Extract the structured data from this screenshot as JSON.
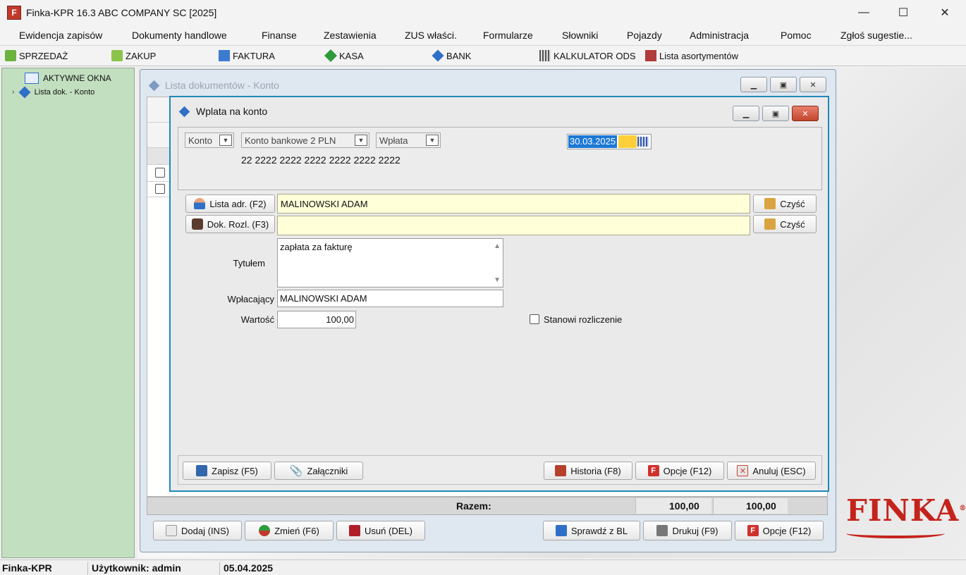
{
  "app": {
    "title": "Finka-KPR 16.3 ABC COMPANY SC [2025]",
    "icon": "finka-app-icon"
  },
  "window_controls": {
    "minimize": "—",
    "maximize": "☐",
    "close": "✕"
  },
  "menu": [
    "Ewidencja zapisów",
    "Dokumenty handlowe",
    "Finanse",
    "Zestawienia",
    "ZUS właści.",
    "Formularze",
    "Słowniki",
    "Pojazdy",
    "Administracja",
    "Pomoc",
    "Zgłoś sugestie..."
  ],
  "toolbar": [
    "SPRZEDAŻ",
    "ZAKUP",
    "FAKTURA",
    "KASA",
    "BANK",
    "KALKULATOR ODS",
    "Lista asortymentów"
  ],
  "tree": {
    "root": "AKTYWNE OKNA",
    "child": "Lista dok. - Konto"
  },
  "outer": {
    "title": "Lista dokumentów - Konto",
    "razem_label": "Razem:",
    "razem_value1": "100,00",
    "razem_value2": "100,00",
    "buttons": {
      "add": "Dodaj (INS)",
      "change": "Zmień (F6)",
      "delete": "Usuń (DEL)",
      "check": "Sprawdź z BL",
      "print": "Drukuj (F9)",
      "options": "Opcje (F12)"
    }
  },
  "dialog": {
    "title": "Wplata na konto",
    "combo_konto": "Konto",
    "combo_account": "Konto bankowe 2 PLN",
    "combo_type": "Wpłata",
    "account_number": "22 2222 2222 2222 2222 2222 2222",
    "date": "30.03.2025",
    "btn_lista_adr": "Lista adr. (F2)",
    "lista_adr_value": "MALINOWSKI ADAM",
    "btn_dok_rozl": "Dok. Rozl. (F3)",
    "dok_rozl_value": "",
    "btn_clear": "Czyść",
    "label_tytulem": "Tytułem",
    "tytulem_value": "zapłata za fakturę",
    "label_wplacajacy": "Wpłacający",
    "wplacajacy_value": "MALINOWSKI ADAM",
    "label_wartosc": "Wartość",
    "wartosc_value": "100,00",
    "checkbox_label": "Stanowi rozliczenie",
    "footer": {
      "save": "Zapisz (F5)",
      "attachments": "Załączniki",
      "history": "Historia (F8)",
      "options": "Opcje (F12)",
      "cancel": "Anuluj (ESC)"
    }
  },
  "logo": {
    "text": "FINKA",
    "mark": "®",
    "color": "#c4231c"
  },
  "statusbar": {
    "app": "Finka-KPR",
    "user": "Użytkownik: admin",
    "date": "05.04.2025"
  },
  "colors": {
    "sidebar": "#c2dfc0",
    "dialog_border": "#1e89b8",
    "highlight": "#ffffd8",
    "selection": "#1b78d6"
  }
}
